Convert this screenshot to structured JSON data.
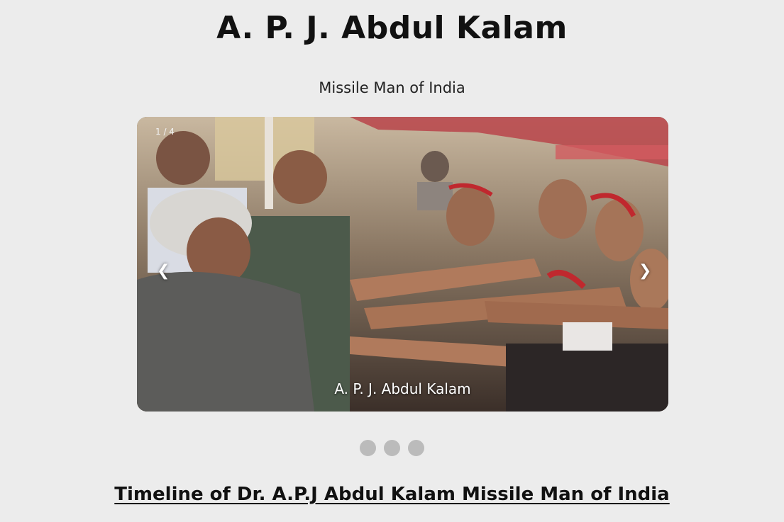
{
  "header": {
    "title": "A. P. J. Abdul Kalam",
    "subtitle": "Missile Man of India"
  },
  "slideshow": {
    "number_text": "1 / 4",
    "prev_label": "❮",
    "next_label": "❯",
    "caption": "A. P. J. Abdul Kalam",
    "dot_count": 3,
    "dot_color": "#bbbbbb"
  },
  "timeline": {
    "heading": "Timeline of Dr. A.P.J Abdul Kalam Missile Man of India"
  },
  "colors": {
    "background": "#ececec",
    "text": "#111111",
    "caption_text": "#ffffff"
  }
}
